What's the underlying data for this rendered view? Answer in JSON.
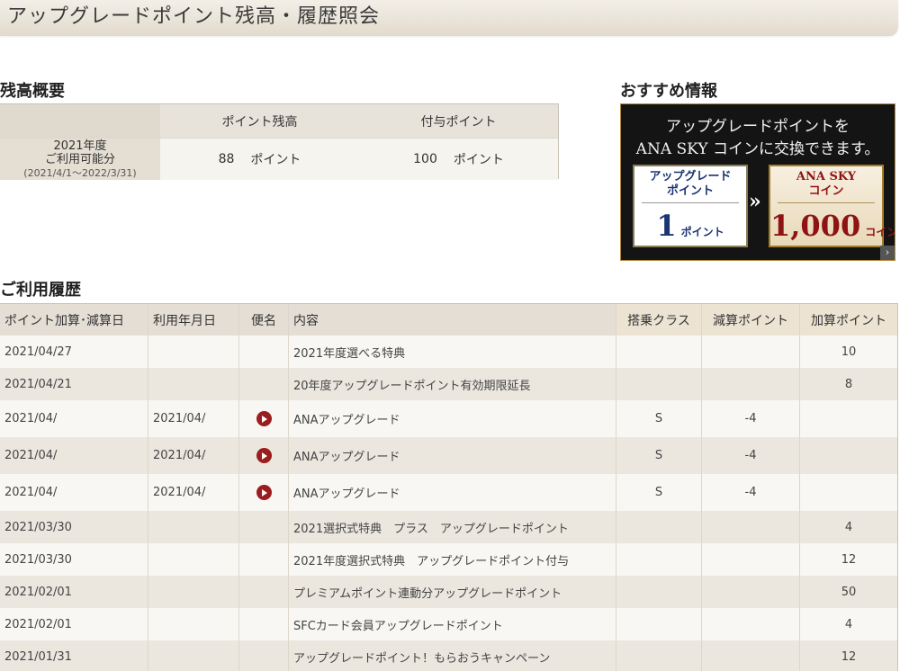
{
  "page": {
    "title": "アップグレードポイント残高・履歴照会"
  },
  "balance": {
    "heading": "残高概要",
    "columns": [
      "ポイント残高",
      "付与ポイント"
    ],
    "row": {
      "label_line1": "2021年度",
      "label_line2": "ご利用可能分",
      "period": "(2021/4/1〜2022/3/31)",
      "balance_value": "88",
      "balance_unit": "ポイント",
      "granted_value": "100",
      "granted_unit": "ポイント"
    }
  },
  "promo": {
    "heading": "おすすめ情報",
    "line1": "アップグレードポイントを",
    "line2": "ANA SKY コインに交換できます。",
    "left_card": {
      "title_line1": "アップグレード",
      "title_line2": "ポイント",
      "amount": "1",
      "unit": "ポイント"
    },
    "right_card": {
      "title_line1": "ANA SKY",
      "title_line2": "コイン",
      "amount": "1,000",
      "unit": "コイン"
    },
    "arrow": "»",
    "corner": "›"
  },
  "history": {
    "heading": "ご利用履歴",
    "columns": {
      "date": "ポイント加算･減算日",
      "usage_date": "利用年月日",
      "flight": "便名",
      "content": "内容",
      "class": "搭乗クラス",
      "deduct": "減算ポイント",
      "add": "加算ポイント"
    },
    "rows": [
      {
        "date": "2021/04/27",
        "usage_date": "",
        "flight": false,
        "content": "2021年度選べる特典",
        "class": "",
        "deduct": "",
        "add": "10"
      },
      {
        "date": "2021/04/21",
        "usage_date": "",
        "flight": false,
        "content": "20年度アップグレードポイント有効期限延長",
        "class": "",
        "deduct": "",
        "add": "8"
      },
      {
        "date": "2021/04/",
        "usage_date": "2021/04/",
        "flight": true,
        "content": "ANAアップグレード",
        "class": "S",
        "deduct": "-4",
        "add": ""
      },
      {
        "date": "2021/04/",
        "usage_date": "2021/04/",
        "flight": true,
        "content": "ANAアップグレード",
        "class": "S",
        "deduct": "-4",
        "add": ""
      },
      {
        "date": "2021/04/",
        "usage_date": "2021/04/",
        "flight": true,
        "content": "ANAアップグレード",
        "class": "S",
        "deduct": "-4",
        "add": ""
      },
      {
        "date": "2021/03/30",
        "usage_date": "",
        "flight": false,
        "content": "2021選択式特典　プラス　アップグレードポイント",
        "class": "",
        "deduct": "",
        "add": "4"
      },
      {
        "date": "2021/03/30",
        "usage_date": "",
        "flight": false,
        "content": "2021年度選択式特典　アップグレードポイント付与",
        "class": "",
        "deduct": "",
        "add": "12"
      },
      {
        "date": "2021/02/01",
        "usage_date": "",
        "flight": false,
        "content": "プレミアムポイント連動分アップグレードポイント",
        "class": "",
        "deduct": "",
        "add": "50"
      },
      {
        "date": "2021/02/01",
        "usage_date": "",
        "flight": false,
        "content": "SFCカード会員アップグレードポイント",
        "class": "",
        "deduct": "",
        "add": "4"
      },
      {
        "date": "2021/01/31",
        "usage_date": "",
        "flight": false,
        "content": "アップグレードポイント！もらおうキャンペーン",
        "class": "",
        "deduct": "",
        "add": "12"
      }
    ]
  },
  "colors": {
    "header_bg": "#e8e3da",
    "row_alt": "#ebe7df",
    "accent_cols": "#efe5d5",
    "play_icon": "#9b1d1d"
  }
}
